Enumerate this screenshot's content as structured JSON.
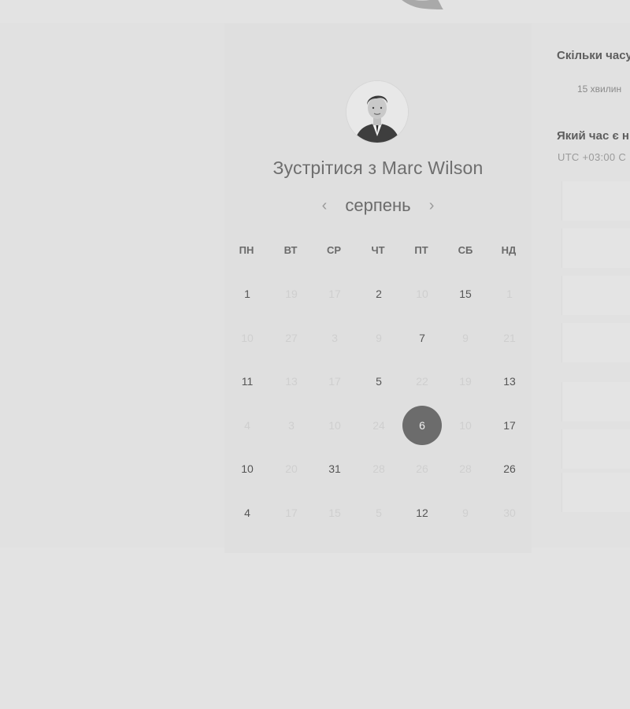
{
  "booking": {
    "title": "Зустрітися з Marc Wilson",
    "month": "серпень",
    "prev_arrow": "‹",
    "next_arrow": "›",
    "weekdays": [
      "ПН",
      "ВТ",
      "СР",
      "ЧТ",
      "ПТ",
      "СБ",
      "НД"
    ],
    "selected_day": "6",
    "weeks": [
      [
        "1",
        "19",
        "17",
        "2",
        "10",
        "15",
        "1"
      ],
      [
        "10",
        "27",
        "3",
        "9",
        "7",
        "9",
        "21"
      ],
      [
        "11",
        "13",
        "17",
        "5",
        "22",
        "19",
        "13"
      ],
      [
        "4",
        "3",
        "10",
        "24",
        "6",
        "10",
        "17"
      ],
      [
        "10",
        "20",
        "31",
        "28",
        "26",
        "28",
        "26"
      ],
      [
        "4",
        "17",
        "15",
        "5",
        "12",
        "9",
        "30"
      ]
    ],
    "available": [
      [
        true,
        false,
        false,
        true,
        false,
        true,
        false
      ],
      [
        false,
        false,
        false,
        false,
        true,
        false,
        false
      ],
      [
        true,
        false,
        false,
        true,
        false,
        false,
        true
      ],
      [
        false,
        false,
        false,
        false,
        true,
        false,
        true
      ],
      [
        true,
        false,
        true,
        false,
        false,
        false,
        true
      ],
      [
        true,
        false,
        false,
        false,
        true,
        false,
        false
      ]
    ]
  },
  "side_panel": {
    "duration_question": "Скільки часу",
    "duration_value": "15 хвилин",
    "time_question": "Який час є н",
    "timezone": "UTC +03:00 С"
  },
  "colors": {
    "background": "#e3e3e3",
    "card": "#dfdfdf",
    "selected": "#6c6c6c",
    "muted_day": "#cfcfcf"
  }
}
